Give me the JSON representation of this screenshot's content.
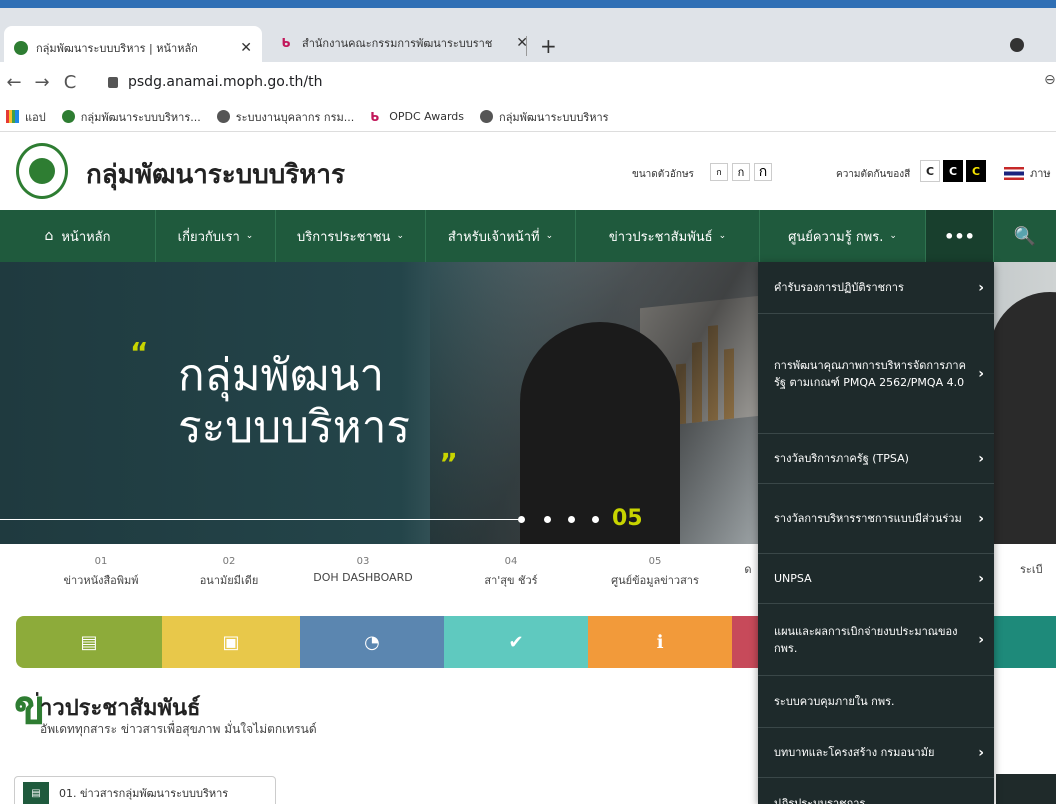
{
  "browser": {
    "tabs": [
      {
        "label": "กลุ่มพัฒนาระบบบริหาร | หน้าหลัก",
        "close": "✕"
      },
      {
        "label": "สำนักงานคณะกรรมการพัฒนาระบบราช",
        "close": "✕"
      }
    ],
    "new_tab": "+",
    "url": "psdg.anamai.moph.go.th/th",
    "nav": {
      "back": "←",
      "forward": "→",
      "reload": "C"
    },
    "url_right": "⊖",
    "bookmarks": [
      "แอป",
      "กลุ่มพัฒนาระบบบริหาร...",
      "ระบบงานบุคลากร กรม...",
      "OPDC Awards",
      "กลุ่มพัฒนาระบบบริหาร"
    ]
  },
  "header": {
    "site_title": "กลุ่มพัฒนาระบบบริหาร",
    "font_size_label": "ขนาดตัวอักษร",
    "font_buttons": [
      "ก",
      "ก",
      "ก"
    ],
    "contrast_label": "ความตัดกันของสี",
    "contrast_buttons": [
      "C",
      "C",
      "C"
    ],
    "language": "ภาษ"
  },
  "nav": {
    "items": [
      {
        "label": "หน้าหลัก"
      },
      {
        "label": "เกี่ยวกับเรา"
      },
      {
        "label": "บริการประชาชน"
      },
      {
        "label": "สำหรับเจ้าหน้าที่"
      },
      {
        "label": "ข่าวประชาสัมพันธ์"
      },
      {
        "label": "ศูนย์ความรู้ กพร."
      }
    ],
    "more": "•••",
    "search": "🔍",
    "chevron": "⌄"
  },
  "hero": {
    "quote_open": "“",
    "title_line1": "กลุ่มพัฒนา",
    "title_line2": "ระบบบริหาร",
    "quote_close": "„",
    "slide_number": "05"
  },
  "quicklinks": [
    {
      "num": "01",
      "label": "ข่าวหนังสือพิมพ์"
    },
    {
      "num": "02",
      "label": "อนามัยมีเดีย"
    },
    {
      "num": "03",
      "label": "DOH DASHBOARD"
    },
    {
      "num": "04",
      "label": "สา'สุข ชัวร์"
    },
    {
      "num": "05",
      "label": "ศูนย์ข้อมูลข่าวสาร"
    },
    {
      "num": "",
      "label": "ด"
    },
    {
      "num": "",
      "label": "ระเบี"
    }
  ],
  "icon_tiles": [
    {
      "icon": "▤",
      "color": "#8dab3a"
    },
    {
      "icon": "▣",
      "color": "#e8c84a"
    },
    {
      "icon": "◔",
      "color": "#5b86b0"
    },
    {
      "icon": "✔",
      "color": "#5fc9bf"
    },
    {
      "icon": "ℹ",
      "color": "#f29a3a"
    },
    {
      "icon": "",
      "color": "#c74a5a"
    },
    {
      "icon": "",
      "color": "#1e8a7a"
    }
  ],
  "news": {
    "ch": "ข",
    "title": "่าวประชาสัมพันธ์",
    "subtitle": "อัพเดททุกสาระ ข่าวสารเพื่อสุขภาพ มั่นใจไม่ตกเทรนด์",
    "card_label": "01. ข่าวสารกลุ่มพัฒนาระบบบริหาร"
  },
  "dropdown": {
    "items": [
      {
        "label": "คำรับรองการปฏิบัติราชการ",
        "arrow": "›"
      },
      {
        "label": "การพัฒนาคุณภาพการบริหารจัดการภาครัฐ ตามเกณฑ์ PMQA 2562/PMQA 4.0",
        "arrow": "›"
      },
      {
        "label": "รางวัลบริการภาครัฐ (TPSA)",
        "arrow": "›"
      },
      {
        "label": "รางวัลการบริหารราชการแบบมีส่วนร่วม",
        "arrow": "›"
      },
      {
        "label": "UNPSA",
        "arrow": "›"
      },
      {
        "label": "แผนและผลการเบิกจ่ายงบประมาณของ กพร.",
        "arrow": "›"
      },
      {
        "label": "ระบบควบคุมภายใน กพร.",
        "arrow": ""
      },
      {
        "label": "บทบาทและโครงสร้าง กรมอนามัย",
        "arrow": "›"
      },
      {
        "label": "ปฏิรูประบบราชการ",
        "arrow": ""
      }
    ]
  }
}
